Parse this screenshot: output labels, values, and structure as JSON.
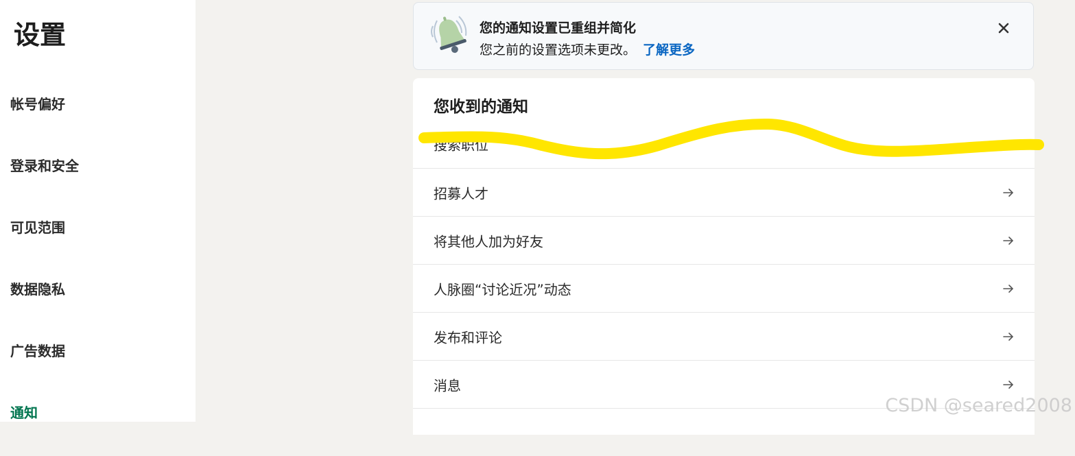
{
  "sidebar": {
    "title": "设置",
    "items": [
      {
        "label": "帐号偏好"
      },
      {
        "label": "登录和安全"
      },
      {
        "label": "可见范围"
      },
      {
        "label": "数据隐私"
      },
      {
        "label": "广告数据"
      },
      {
        "label": "通知"
      }
    ],
    "active_color": "#01754f"
  },
  "banner": {
    "headline": "您的通知设置已重组并简化",
    "subline": "您之前的设置选项未更改。",
    "learn_more": "了解更多",
    "icon": "bell-icon",
    "close_icon": "close-icon"
  },
  "notifications": {
    "title": "您收到的通知",
    "rows": [
      {
        "label": "搜索职位"
      },
      {
        "label": "招募人才"
      },
      {
        "label": "将其他人加为好友"
      },
      {
        "label": "人脉圈“讨论近况”动态"
      },
      {
        "label": "发布和评论"
      },
      {
        "label": "消息"
      }
    ],
    "row_icon": "arrow-right-icon"
  },
  "watermark": "CSDN @seared2008",
  "colors": {
    "link": "#0a66c2",
    "highlight": "#ffe600",
    "page_bg": "#f3f2ef"
  }
}
